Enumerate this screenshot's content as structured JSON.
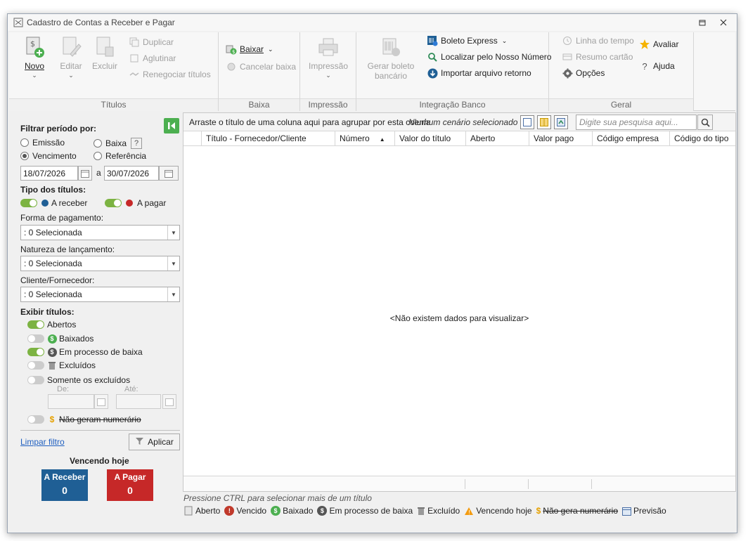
{
  "window": {
    "title": "Cadastro de Contas a Receber e Pagar"
  },
  "ribbon": {
    "titulos": {
      "label": "Títulos",
      "novo": "Novo",
      "editar": "Editar",
      "excluir": "Excluir",
      "duplicar": "Duplicar",
      "aglutinar": "Aglutinar",
      "renegociar": "Renegociar títulos"
    },
    "baixa": {
      "label": "Baixa",
      "baixar": "Baixar",
      "cancelar": "Cancelar baixa"
    },
    "impressao": {
      "label": "Impressão",
      "impressao": "Impressão"
    },
    "integracao": {
      "label": "Integração Banco",
      "gerar_boleto": "Gerar boleto bancário",
      "boleto_express": "Boleto Express",
      "localizar": "Localizar pelo Nosso Número",
      "importar": "Importar arquivo retorno"
    },
    "geral": {
      "label": "Geral",
      "linha_tempo": "Linha do tempo",
      "resumo_cartao": "Resumo cartão",
      "opcoes": "Opções",
      "avaliar": "Avaliar",
      "ajuda": "Ajuda"
    }
  },
  "filter": {
    "periodo_label": "Filtrar período por:",
    "emissao": "Emissão",
    "baixa": "Baixa",
    "vencimento": "Vencimento",
    "referencia": "Referência",
    "date_from": "18/07/2026",
    "date_sep": "a",
    "date_to": "30/07/2026",
    "tipo_label": "Tipo dos títulos:",
    "a_receber": "A receber",
    "a_pagar": "A pagar",
    "forma_label": "Forma de pagamento:",
    "forma_value": ": 0 Selecionada",
    "natureza_label": "Natureza de lançamento:",
    "natureza_value": ": 0 Selecionada",
    "cliente_label": "Cliente/Fornecedor:",
    "cliente_value": ": 0 Selecionada",
    "exibir_label": "Exibir títulos:",
    "abertos": "Abertos",
    "baixados": "Baixados",
    "em_processo": "Em processo de baixa",
    "excluidos": "Excluídos",
    "somente_excluidos": "Somente os excluídos",
    "de": "De:",
    "ate": "Até:",
    "nao_geram": "Não geram numerário",
    "limpar": "Limpar filtro",
    "aplicar": "Aplicar",
    "vencendo_hoje": "Vencendo hoje",
    "tile_receber_label": "A Receber",
    "tile_receber_value": "0",
    "tile_pagar_label": "A Pagar",
    "tile_pagar_value": "0"
  },
  "grid": {
    "group_hint": "Arraste o título de uma coluna aqui para agrupar por esta coluna",
    "scenario": "Nenhum cenário selecionado",
    "search_placeholder": "Digite sua pesquisa aqui...",
    "columns": [
      "Título - Fornecedor/Cliente",
      "Número",
      "Valor do título",
      "Aberto",
      "Valor pago",
      "Código empresa",
      "Código do tipo"
    ],
    "empty": "<Não existem dados para visualizar>"
  },
  "footer": {
    "hint": "Pressione CTRL para selecionar mais de um título",
    "legend": [
      "Aberto",
      "Vencido",
      "Baixado",
      "Em processo de baixa",
      "Excluído",
      "Vencendo hoje",
      "Não gera numerário",
      "Previsão"
    ]
  },
  "colors": {
    "accent_green": "#7cb342",
    "receber_blue": "#1f5f95",
    "pagar_red": "#c62828"
  }
}
